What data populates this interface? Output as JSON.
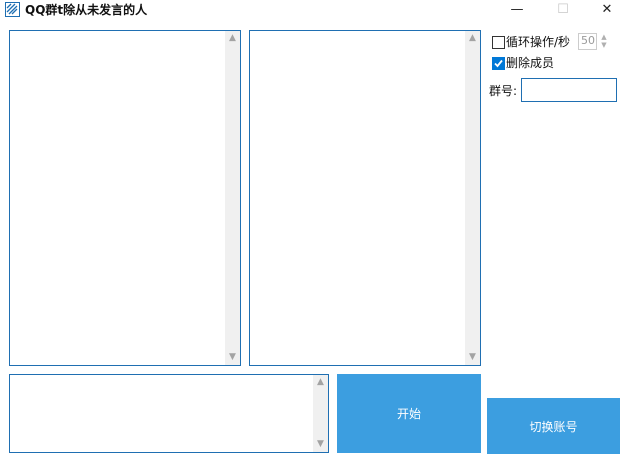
{
  "window": {
    "title": "QQ群t除从未发言的人",
    "minimize_glyph": "—",
    "maximize_glyph": "☐",
    "close_glyph": "✕"
  },
  "icons": {
    "scroll_up": "▲",
    "scroll_down": "▼",
    "spin_up": "▲",
    "spin_down": "▼"
  },
  "options": {
    "loop_label": "循环操作/秒",
    "loop_checked": false,
    "loop_value": "50",
    "delete_label": "删除成员",
    "delete_checked": true,
    "group_label": "群号:",
    "group_value": ""
  },
  "buttons": {
    "start_label": "开始",
    "switch_label": "切换账号"
  },
  "colors": {
    "accent": "#3c9ee0",
    "border": "#1f6fb2",
    "checkbox_checked": "#0078d7"
  }
}
